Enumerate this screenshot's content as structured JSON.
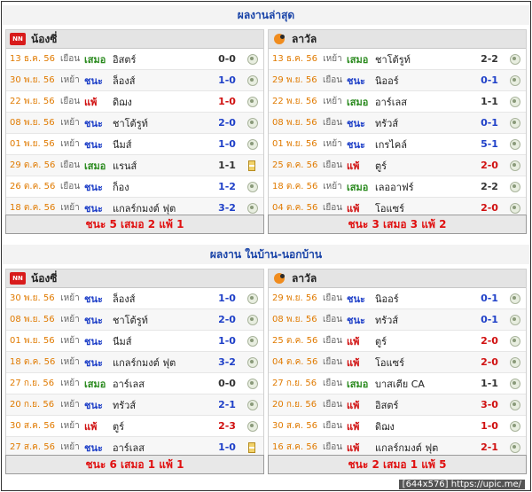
{
  "section1": {
    "title": "ผลงานล่าสุด",
    "left": {
      "team": "น้องซี่",
      "summary": "ชนะ 5 เสมอ 2 แพ้ 1",
      "rows": [
        {
          "date": "13 ธ.ค. 56",
          "loc": "เยือน",
          "res": "เสมอ",
          "type": "draw",
          "opp": "อิสตร์",
          "score": "0-0",
          "icon": "ball"
        },
        {
          "date": "30 พ.ย. 56",
          "loc": "เหย้า",
          "res": "ชนะ",
          "type": "win",
          "opp": "ล็องส์",
          "score": "1-0",
          "icon": "ball"
        },
        {
          "date": "22 พ.ย. 56",
          "loc": "เยือน",
          "res": "แพ้",
          "type": "loss",
          "opp": "ดิฌง",
          "score": "1-0",
          "icon": "ball"
        },
        {
          "date": "08 พ.ย. 56",
          "loc": "เหย้า",
          "res": "ชนะ",
          "type": "win",
          "opp": "ชาโต้รูท์",
          "score": "2-0",
          "icon": "ball"
        },
        {
          "date": "01 พ.ย. 56",
          "loc": "เหย้า",
          "res": "ชนะ",
          "type": "win",
          "opp": "นีมส์",
          "score": "1-0",
          "icon": "ball"
        },
        {
          "date": "29 ต.ค. 56",
          "loc": "เยือน",
          "res": "เสมอ",
          "type": "draw",
          "opp": "แรนส์",
          "score": "1-1",
          "icon": "clock"
        },
        {
          "date": "26 ต.ค. 56",
          "loc": "เยือน",
          "res": "ชนะ",
          "type": "win",
          "opp": "ก็อง",
          "score": "1-2",
          "icon": "ball"
        },
        {
          "date": "18 ต.ค. 56",
          "loc": "เหย้า",
          "res": "ชนะ",
          "type": "win",
          "opp": "แกลร์กมงต์ ฟุต",
          "score": "3-2",
          "icon": "ball"
        }
      ]
    },
    "right": {
      "team": "ลาวัล",
      "summary": "ชนะ 3 เสมอ 3 แพ้ 2",
      "rows": [
        {
          "date": "13 ธ.ค. 56",
          "loc": "เหย้า",
          "res": "เสมอ",
          "type": "draw",
          "opp": "ชาโต้รูท์",
          "score": "2-2",
          "icon": "ball"
        },
        {
          "date": "29 พ.ย. 56",
          "loc": "เยือน",
          "res": "ชนะ",
          "type": "win",
          "opp": "นิออร์",
          "score": "0-1",
          "icon": "ball"
        },
        {
          "date": "22 พ.ย. 56",
          "loc": "เหย้า",
          "res": "เสมอ",
          "type": "draw",
          "opp": "อาร์เลส",
          "score": "1-1",
          "icon": "ball"
        },
        {
          "date": "08 พ.ย. 56",
          "loc": "เยือน",
          "res": "ชนะ",
          "type": "win",
          "opp": "ทรัวส์",
          "score": "0-1",
          "icon": "ball"
        },
        {
          "date": "01 พ.ย. 56",
          "loc": "เหย้า",
          "res": "ชนะ",
          "type": "win",
          "opp": "เกรไคล์",
          "score": "5-1",
          "icon": "ball"
        },
        {
          "date": "25 ต.ค. 56",
          "loc": "เยือน",
          "res": "แพ้",
          "type": "loss",
          "opp": "ตูร์",
          "score": "2-0",
          "icon": "ball"
        },
        {
          "date": "18 ต.ค. 56",
          "loc": "เหย้า",
          "res": "เสมอ",
          "type": "draw",
          "opp": "เลออาฟร์",
          "score": "2-2",
          "icon": "ball"
        },
        {
          "date": "04 ต.ค. 56",
          "loc": "เยือน",
          "res": "แพ้",
          "type": "loss",
          "opp": "โอแซร์",
          "score": "2-0",
          "icon": "ball"
        }
      ]
    }
  },
  "section2": {
    "title": "ผลงาน ในบ้าน-นอกบ้าน",
    "left": {
      "team": "น้องซี่",
      "summary": "ชนะ 6 เสมอ 1 แพ้ 1",
      "rows": [
        {
          "date": "30 พ.ย. 56",
          "loc": "เหย้า",
          "res": "ชนะ",
          "type": "win",
          "opp": "ล็องส์",
          "score": "1-0",
          "icon": "ball"
        },
        {
          "date": "08 พ.ย. 56",
          "loc": "เหย้า",
          "res": "ชนะ",
          "type": "win",
          "opp": "ชาโต้รูท์",
          "score": "2-0",
          "icon": "ball"
        },
        {
          "date": "01 พ.ย. 56",
          "loc": "เหย้า",
          "res": "ชนะ",
          "type": "win",
          "opp": "นีมส์",
          "score": "1-0",
          "icon": "ball"
        },
        {
          "date": "18 ต.ค. 56",
          "loc": "เหย้า",
          "res": "ชนะ",
          "type": "win",
          "opp": "แกลร์กมงต์ ฟุต",
          "score": "3-2",
          "icon": "ball"
        },
        {
          "date": "27 ก.ย. 56",
          "loc": "เหย้า",
          "res": "เสมอ",
          "type": "draw",
          "opp": "อาร์เลส",
          "score": "0-0",
          "icon": "ball"
        },
        {
          "date": "20 ก.ย. 56",
          "loc": "เหย้า",
          "res": "ชนะ",
          "type": "win",
          "opp": "ทรัวส์",
          "score": "2-1",
          "icon": "ball"
        },
        {
          "date": "30 ส.ค. 56",
          "loc": "เหย้า",
          "res": "แพ้",
          "type": "loss",
          "opp": "ตูร์",
          "score": "2-3",
          "icon": "ball"
        },
        {
          "date": "27 ส.ค. 56",
          "loc": "เหย้า",
          "res": "ชนะ",
          "type": "win",
          "opp": "อาร์เลส",
          "score": "1-0",
          "icon": "clock"
        }
      ]
    },
    "right": {
      "team": "ลาวัล",
      "summary": "ชนะ 2 เสมอ 1 แพ้ 5",
      "rows": [
        {
          "date": "29 พ.ย. 56",
          "loc": "เยือน",
          "res": "ชนะ",
          "type": "win",
          "opp": "นิออร์",
          "score": "0-1",
          "icon": "ball"
        },
        {
          "date": "08 พ.ย. 56",
          "loc": "เยือน",
          "res": "ชนะ",
          "type": "win",
          "opp": "ทรัวส์",
          "score": "0-1",
          "icon": "ball"
        },
        {
          "date": "25 ต.ค. 56",
          "loc": "เยือน",
          "res": "แพ้",
          "type": "loss",
          "opp": "ตูร์",
          "score": "2-0",
          "icon": "ball"
        },
        {
          "date": "04 ต.ค. 56",
          "loc": "เยือน",
          "res": "แพ้",
          "type": "loss",
          "opp": "โอแซร์",
          "score": "2-0",
          "icon": "ball"
        },
        {
          "date": "27 ก.ย. 56",
          "loc": "เยือน",
          "res": "เสมอ",
          "type": "draw",
          "opp": "บาสเตีย CA",
          "score": "1-1",
          "icon": "ball"
        },
        {
          "date": "20 ก.ย. 56",
          "loc": "เยือน",
          "res": "แพ้",
          "type": "loss",
          "opp": "อิสตร์",
          "score": "3-0",
          "icon": "ball"
        },
        {
          "date": "30 ส.ค. 56",
          "loc": "เยือน",
          "res": "แพ้",
          "type": "loss",
          "opp": "ดิฌง",
          "score": "1-0",
          "icon": "ball"
        },
        {
          "date": "16 ส.ค. 56",
          "loc": "เยือน",
          "res": "แพ้",
          "type": "loss",
          "opp": "แกลร์กมงต์ ฟุต",
          "score": "2-1",
          "icon": "ball"
        }
      ]
    }
  },
  "watermark": "[644x576] https://upic.me/",
  "colors": {
    "title": "#1a44a8",
    "date": "#e07a00",
    "win": "#1f40c8",
    "draw": "#2a8a1e",
    "loss": "#d01010",
    "summary": "#e01010"
  }
}
